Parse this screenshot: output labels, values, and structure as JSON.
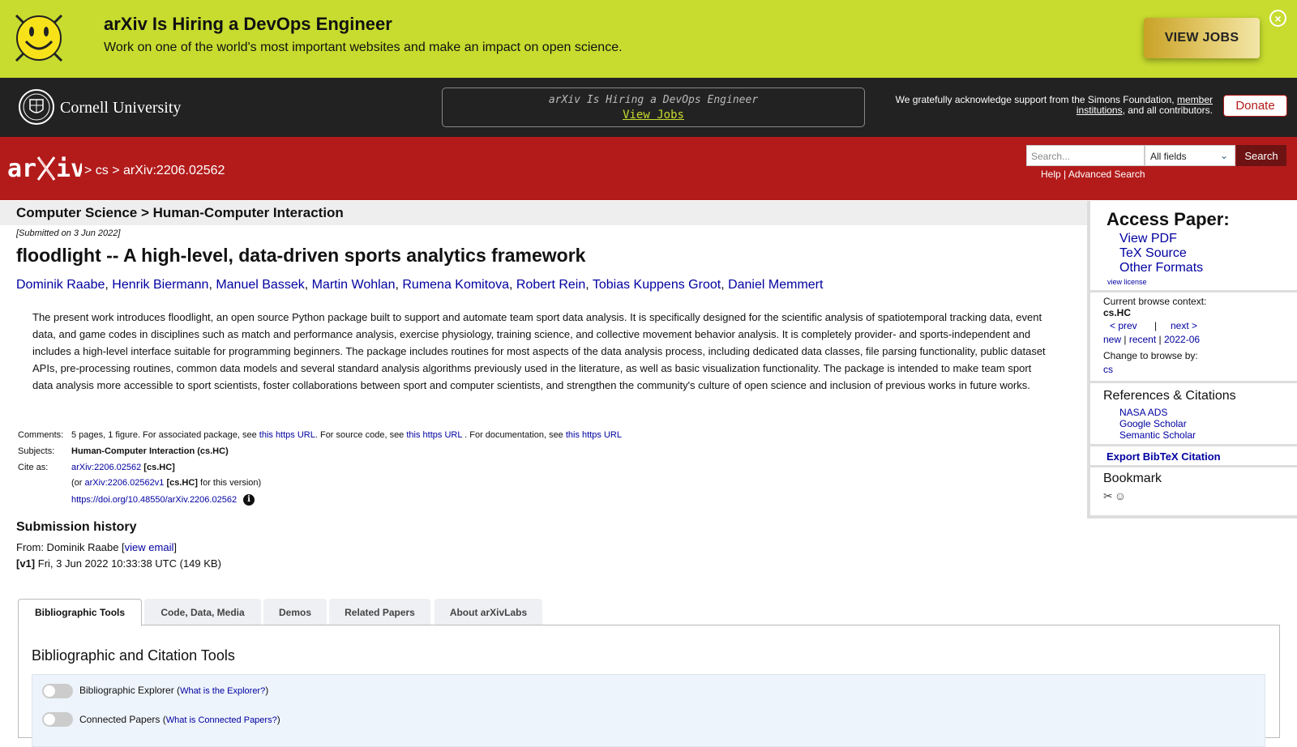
{
  "hiring": {
    "title": "arXiv Is Hiring a DevOps Engineer",
    "subtitle": "Work on one of the world's most important websites and make an impact on open science.",
    "button": "VIEW JOBS"
  },
  "cornell": {
    "name": "Cornell University",
    "slot_title": "arXiv Is Hiring a DevOps Engineer",
    "slot_link": "View Jobs",
    "support_text": "We gratefully acknowledge support from the Simons Foundation,",
    "support_link": "member institutions",
    "support_tail": ", and all contributors.",
    "donate": "Donate"
  },
  "header": {
    "crumbs": "> cs > arXiv:2206.02562",
    "search_placeholder": "Search...",
    "fields_value": "All fields",
    "search_button": "Search",
    "help": "Help",
    "sep": "|",
    "advanced": "Advanced Search"
  },
  "paper": {
    "subject_bar": "Computer Science > Human-Computer Interaction",
    "submitted": "[Submitted on 3 Jun 2022]",
    "title": "floodlight -- A high-level, data-driven sports analytics framework",
    "authors": [
      "Dominik Raabe",
      "Henrik Biermann",
      "Manuel Bassek",
      "Martin Wohlan",
      "Rumena Komitova",
      "Robert Rein",
      "Tobias Kuppens Groot",
      "Daniel Memmert"
    ],
    "abstract": "The present work introduces floodlight, an open source Python package built to support and automate team sport data analysis. It is specifically designed for the scientific analysis of spatiotemporal tracking data, event data, and game codes in disciplines such as match and performance analysis, exercise physiology, training science, and collective movement behavior analysis. It is completely provider- and sports-independent and includes a high-level interface suitable for programming beginners. The package includes routines for most aspects of the data analysis process, including dedicated data classes, file parsing functionality, public dataset APIs, pre-processing routines, common data models and several standard analysis algorithms previously used in the literature, as well as basic visualization functionality. The package is intended to make team sport data analysis more accessible to sport scientists, foster collaborations between sport and computer scientists, and strengthen the community's culture of open science and inclusion of previous works in future works."
  },
  "meta": {
    "comments_label": "Comments:",
    "comments_a": "5 pages, 1 figure. For associated package, see",
    "comments_link1": "this https URL",
    "comments_b": ". For source code, see",
    "comments_link2": "this https URL",
    "comments_c": ". For documentation, see",
    "comments_link3": "this https URL",
    "subjects_label": "Subjects:",
    "subjects_value": "Human-Computer Interaction (cs.HC)",
    "cite_label": "Cite as:",
    "cite_id": "arXiv:2206.02562",
    "cite_tag": "[cs.HC]",
    "cite_or": "(or",
    "cite_v1": "arXiv:2206.02562v1",
    "cite_tag2": "[cs.HC]",
    "cite_version": "for this version)",
    "doi": "https://doi.org/10.48550/arXiv.2206.02562"
  },
  "history": {
    "heading": "Submission history",
    "from_text": "From: Dominik Raabe [",
    "view_email": "view email",
    "from_close": "]",
    "v1_label": "[v1]",
    "v1_text": "Fri, 3 Jun 2022 10:33:38 UTC (149 KB)"
  },
  "tabs": [
    "Bibliographic Tools",
    "Code, Data, Media",
    "Demos",
    "Related Papers",
    "About arXivLabs"
  ],
  "panel": {
    "heading": "Bibliographic and Citation Tools",
    "tool1": "Bibliographic Explorer (",
    "tool1_link": "What is the Explorer?",
    "tool2": "Connected Papers (",
    "tool2_link": "What is Connected Papers?",
    "close_paren": ")"
  },
  "sidebar": {
    "access_heading": "Access Paper:",
    "links": [
      "View PDF",
      "TeX Source",
      "Other Formats"
    ],
    "view_license": "view license",
    "context_label": "Current browse context:",
    "context_value": "cs.HC",
    "prev": "< prev",
    "bar": "|",
    "next": "next >",
    "new": "new",
    "recent": "recent",
    "date": "2022-06",
    "change_label": "Change to browse by:",
    "change_value": "cs",
    "refs_heading": "References & Citations",
    "refs": [
      "NASA ADS",
      "Google Scholar",
      "Semantic Scholar"
    ],
    "bibtex": "Export BibTeX Citation",
    "bookmark": "Bookmark"
  },
  "icons": {
    "close": "close-circle-icon",
    "info": "info-icon",
    "bookmark": [
      "bibsonomy-icon",
      "reddit-icon"
    ]
  },
  "colors": {
    "banner": "#c7dc2f",
    "arxiv_red": "#b31b1b",
    "cornell_bar": "#222222",
    "link": "#0000a0"
  }
}
